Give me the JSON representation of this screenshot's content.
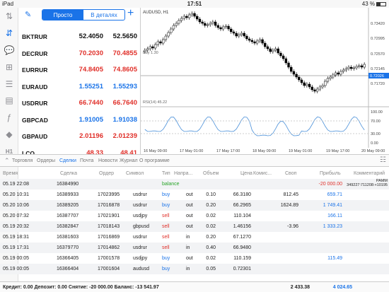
{
  "status": {
    "device": "iPad",
    "time": "17:51",
    "battery": "43 %"
  },
  "header": {
    "tab_simple": "Просто",
    "tab_detailed": "В деталях"
  },
  "quotes": [
    {
      "symbol": "BKTRUR",
      "bid": "52.4050",
      "ask": "52.5650",
      "dir": "nt"
    },
    {
      "symbol": "DECRUR",
      "bid": "70.2030",
      "ask": "70.4855",
      "dir": "dn"
    },
    {
      "symbol": "EURRUR",
      "bid": "74.8405",
      "ask": "74.8605",
      "dir": "dn"
    },
    {
      "symbol": "EURAUD",
      "bid": "1.55251",
      "ask": "1.55293",
      "dir": "up"
    },
    {
      "symbol": "USDRUR",
      "bid": "66.7440",
      "ask": "66.7640",
      "dir": "dn"
    },
    {
      "symbol": "GBPCAD",
      "bid": "1.91005",
      "ask": "1.91038",
      "dir": "up"
    },
    {
      "symbol": "GBPAUD",
      "bid": "2.01196",
      "ask": "2.01239",
      "dir": "dn"
    },
    {
      "symbol": "LCO",
      "bid": "48.33",
      "ask": "48.41",
      "dir": "dn"
    }
  ],
  "chart": {
    "title": "AUDUSD, H1",
    "price_label": "Buy 1.30",
    "indicator_label": "RSI(14) 45.22",
    "price_ticks": [
      "0.73420",
      "0.72995",
      "0.72570",
      "0.72145",
      "0.71720"
    ],
    "current_price": "0.72026",
    "rsi_ticks": [
      "100.00",
      "70.00",
      "30.00",
      "0.00"
    ],
    "time_ticks": [
      "16 May 09:00",
      "17 May 01:00",
      "17 May 17:00",
      "18 May 09:00",
      "19 May 01:00",
      "19 May 17:00",
      "20 May 09:00"
    ],
    "colors": {
      "bull": "#ffffff",
      "bear": "#000000",
      "rsi": "#4a90d9",
      "current": "#1a73e8"
    }
  },
  "tabs": [
    "Торговля",
    "Ордеры",
    "Сделки",
    "Почта",
    "Новости",
    "Журнал",
    "О программе"
  ],
  "table": {
    "headers": [
      "Время",
      "Сделка",
      "Ордер",
      "Символ",
      "Тип",
      "Напра...",
      "Объем",
      "Цена",
      "Комис...",
      "Своп",
      "Прибыль",
      "Комментарий"
    ],
    "rows": [
      {
        "time": "05.19 22:08",
        "deal": "16384990",
        "order": "",
        "symbol": "",
        "type": "balance",
        "dir": "",
        "volume": "",
        "price": "",
        "commission": "",
        "swap": "",
        "profit": "-20 000.00",
        "comment": "PAMM 349227:711208:+10195"
      },
      {
        "time": "05.20 10:31",
        "deal": "16389933",
        "order": "17023995",
        "symbol": "usdrur",
        "type": "buy",
        "dir": "out",
        "volume": "0.10",
        "price": "66.3180",
        "commission": "",
        "swap": "812.45",
        "profit": "659.71",
        "comment": ""
      },
      {
        "time": "05.20 10:06",
        "deal": "16389205",
        "order": "17016878",
        "symbol": "usdrur",
        "type": "buy",
        "dir": "out",
        "volume": "0.20",
        "price": "66.2965",
        "commission": "",
        "swap": "1624.89",
        "profit": "1 749.41",
        "comment": ""
      },
      {
        "time": "05.20 07:32",
        "deal": "16387707",
        "order": "17021901",
        "symbol": "usdjpy",
        "type": "sell",
        "dir": "out",
        "volume": "0.02",
        "price": "110.104",
        "commission": "",
        "swap": "",
        "profit": "166.11",
        "comment": ""
      },
      {
        "time": "05.19 20:32",
        "deal": "16382847",
        "order": "17018143",
        "symbol": "gbpusd",
        "type": "sell",
        "dir": "out",
        "volume": "0.02",
        "price": "1.46156",
        "commission": "",
        "swap": "-3.96",
        "profit": "1 333.23",
        "comment": ""
      },
      {
        "time": "05.19 18:31",
        "deal": "16381603",
        "order": "17016869",
        "symbol": "usdrur",
        "type": "sell",
        "dir": "in",
        "volume": "0.20",
        "price": "67.1270",
        "commission": "",
        "swap": "",
        "profit": "",
        "comment": ""
      },
      {
        "time": "05.19 17:31",
        "deal": "16379770",
        "order": "17014862",
        "symbol": "usdrur",
        "type": "sell",
        "dir": "in",
        "volume": "0.40",
        "price": "66.9480",
        "commission": "",
        "swap": "",
        "profit": "",
        "comment": ""
      },
      {
        "time": "05.19 00:05",
        "deal": "16366405",
        "order": "17001578",
        "symbol": "usdjpy",
        "type": "buy",
        "dir": "out",
        "volume": "0.02",
        "price": "110.159",
        "commission": "",
        "swap": "",
        "profit": "115.49",
        "comment": ""
      },
      {
        "time": "05.19 00:05",
        "deal": "16366404",
        "order": "17001604",
        "symbol": "audusd",
        "type": "buy",
        "dir": "in",
        "volume": "0.05",
        "price": "0.72301",
        "commission": "",
        "swap": "",
        "profit": "",
        "comment": ""
      }
    ]
  },
  "footer": {
    "summary": "Кредит: 0.00 Депозит: 0.00 Снятие: -20 000.00 Баланс: -13 541.97",
    "swap_total": "2 433.38",
    "profit_total": "4 024.65"
  }
}
